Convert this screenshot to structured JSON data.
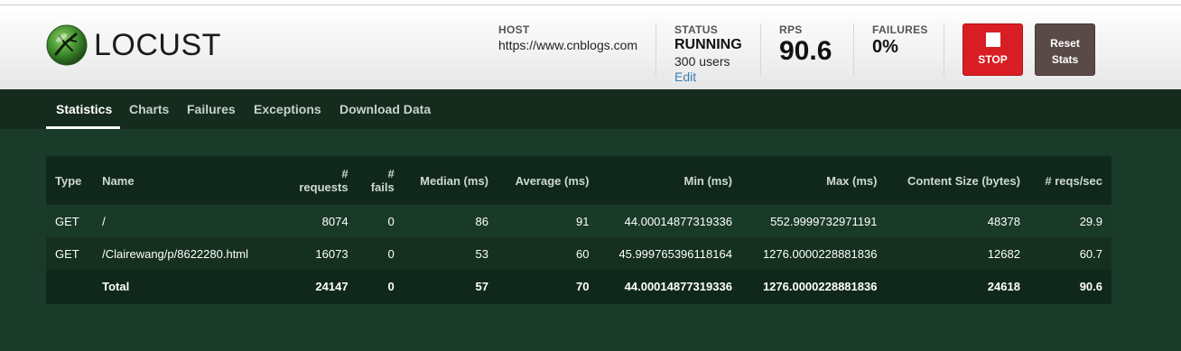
{
  "app": {
    "logo_text": "LOCUST"
  },
  "header": {
    "host_label": "HOST",
    "host_value": "https://www.cnblogs.com",
    "status_label": "STATUS",
    "status_value": "RUNNING",
    "users_value": "300 users",
    "edit_label": "Edit",
    "rps_label": "RPS",
    "rps_value": "90.6",
    "failures_label": "FAILURES",
    "failures_value": "0%",
    "stop_label": "STOP",
    "reset_label_line1": "Reset",
    "reset_label_line2": "Stats"
  },
  "nav": {
    "tabs": [
      {
        "label": "Statistics"
      },
      {
        "label": "Charts"
      },
      {
        "label": "Failures"
      },
      {
        "label": "Exceptions"
      },
      {
        "label": "Download Data"
      }
    ],
    "active": "Statistics"
  },
  "table": {
    "headers": {
      "type": "Type",
      "name": "Name",
      "requests_l1": "#",
      "requests_l2": "requests",
      "fails_l1": "#",
      "fails_l2": "fails",
      "median": "Median (ms)",
      "average": "Average (ms)",
      "min": "Min (ms)",
      "max": "Max (ms)",
      "content_size": "Content Size (bytes)",
      "reqs_sec": "# reqs/sec"
    },
    "rows": [
      {
        "type": "GET",
        "name": "/",
        "requests": "8074",
        "fails": "0",
        "median": "86",
        "average": "91",
        "min": "44.00014877319336",
        "max": "552.9999732971191",
        "content_size": "48378",
        "reqs_sec": "29.9"
      },
      {
        "type": "GET",
        "name": "/Clairewang/p/8622280.html",
        "requests": "16073",
        "fails": "0",
        "median": "53",
        "average": "60",
        "min": "45.999765396118164",
        "max": "1276.0000228881836",
        "content_size": "12682",
        "reqs_sec": "60.7"
      }
    ],
    "total": {
      "type": "",
      "name": "Total",
      "requests": "24147",
      "fails": "0",
      "median": "57",
      "average": "70",
      "min": "44.00014877319336",
      "max": "1276.0000228881836",
      "content_size": "24618",
      "reqs_sec": "90.6"
    }
  },
  "colors": {
    "stop": "#d81e24",
    "reset": "#5a4a47",
    "bg": "#1b3b2a",
    "edit_link": "#3c7fb5"
  },
  "icons": {
    "logo": "locust-logo-icon",
    "stop": "stop-square-icon"
  }
}
